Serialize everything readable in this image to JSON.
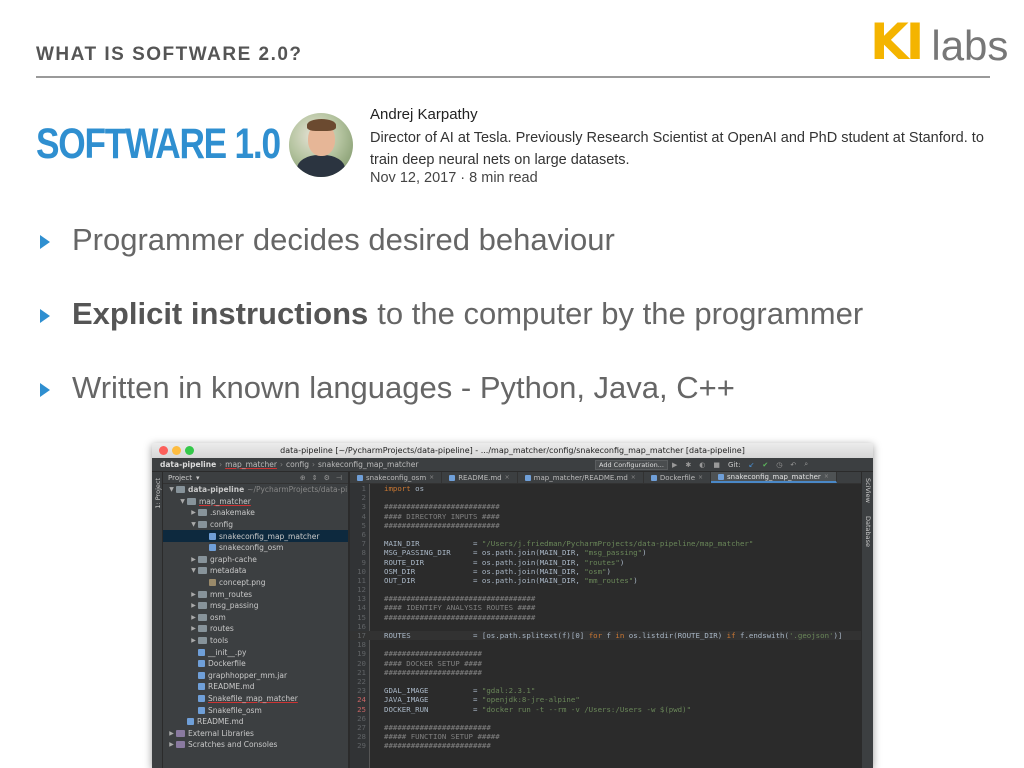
{
  "slide": {
    "header": "WHAT IS SOFTWARE 2.0?",
    "title": "SOFTWARE 1.0",
    "logo": {
      "ki": "KI",
      "labs": "labs",
      "color": "#f4b400"
    },
    "accent_color": "#2f8fd0"
  },
  "author": {
    "name": "Andrej Karpathy",
    "bio": "Director of AI at Tesla. Previously Research Scientist at OpenAI and PhD student at Stanford. to train deep neural nets on large datasets.",
    "meta": "Nov 12, 2017 · 8 min read"
  },
  "bullets": [
    {
      "bold": "",
      "text": "Programmer decides desired behaviour"
    },
    {
      "bold": "Explicit instructions",
      "text": "to the computer by the programmer"
    },
    {
      "bold": "",
      "text": "Written in known languages - Python, Java, C++"
    }
  ],
  "ide": {
    "window_title": "data-pipeline [~/PycharmProjects/data-pipeline] - .../map_matcher/config/snakeconfig_map_matcher [data-pipeline]",
    "breadcrumb": [
      "data-pipeline",
      "map_matcher",
      "config",
      "snakeconfig_map_matcher"
    ],
    "add_configuration": "Add Configuration...",
    "git_label": "Git:",
    "left_tool_label": "1: Project",
    "right_tool_labels": [
      "SciView",
      "Database"
    ],
    "project_panel_title": "Project",
    "tree": [
      {
        "label": "data-pipeline",
        "suffix": "~/PycharmProjects/data-pi",
        "type": "folder",
        "arrow": "▼"
      },
      {
        "label": "map_matcher",
        "type": "folder",
        "arrow": "▼"
      },
      {
        "label": ".snakemake",
        "type": "folder",
        "arrow": "▶"
      },
      {
        "label": "config",
        "type": "folder",
        "arrow": "▼"
      },
      {
        "label": "snakeconfig_map_matcher",
        "type": "file",
        "arrow": ""
      },
      {
        "label": "snakeconfig_osm",
        "type": "file",
        "arrow": ""
      },
      {
        "label": "graph-cache",
        "type": "folder",
        "arrow": "▶"
      },
      {
        "label": "metadata",
        "type": "folder",
        "arrow": "▼"
      },
      {
        "label": "concept.png",
        "type": "img",
        "arrow": ""
      },
      {
        "label": "mm_routes",
        "type": "folder",
        "arrow": "▶"
      },
      {
        "label": "msg_passing",
        "type": "folder",
        "arrow": "▶"
      },
      {
        "label": "osm",
        "type": "folder",
        "arrow": "▶"
      },
      {
        "label": "routes",
        "type": "folder",
        "arrow": "▶"
      },
      {
        "label": "tools",
        "type": "folder",
        "arrow": "▶"
      },
      {
        "label": "__init__.py",
        "type": "file",
        "arrow": ""
      },
      {
        "label": "Dockerfile",
        "type": "file",
        "arrow": ""
      },
      {
        "label": "graphhopper_mm.jar",
        "type": "file",
        "arrow": ""
      },
      {
        "label": "README.md",
        "type": "file",
        "arrow": ""
      },
      {
        "label": "Snakefile_map_matcher",
        "type": "file",
        "arrow": ""
      },
      {
        "label": "Snakefile_osm",
        "type": "file",
        "arrow": ""
      },
      {
        "label": "README.md",
        "type": "file",
        "arrow": ""
      },
      {
        "label": "External Libraries",
        "type": "lib",
        "arrow": "▶"
      },
      {
        "label": "Scratches and Consoles",
        "type": "lib",
        "arrow": "▶"
      }
    ],
    "tabs": [
      {
        "label": "snakeconfig_osm",
        "active": false
      },
      {
        "label": "README.md",
        "active": false
      },
      {
        "label": "map_matcher/README.md",
        "active": false
      },
      {
        "label": "Dockerfile",
        "active": false
      },
      {
        "label": "snakeconfig_map_matcher",
        "active": true
      }
    ],
    "code": [
      {
        "n": "1",
        "t": "import os"
      },
      {
        "n": "2",
        "t": ""
      },
      {
        "n": "3",
        "t": "##########################"
      },
      {
        "n": "4",
        "t": "#### DIRECTORY INPUTS ####"
      },
      {
        "n": "5",
        "t": "##########################"
      },
      {
        "n": "6",
        "t": ""
      },
      {
        "n": "7",
        "t": "MAIN_DIR            = \"/Users/j.friedman/PycharmProjects/data-pipeline/map_matcher\""
      },
      {
        "n": "8",
        "t": "MSG_PASSING_DIR     = os.path.join(MAIN_DIR, \"msg_passing\")"
      },
      {
        "n": "9",
        "t": "ROUTE_DIR           = os.path.join(MAIN_DIR, \"routes\")"
      },
      {
        "n": "10",
        "t": "OSM_DIR             = os.path.join(MAIN_DIR, \"osm\")"
      },
      {
        "n": "11",
        "t": "OUT_DIR             = os.path.join(MAIN_DIR, \"mm_routes\")"
      },
      {
        "n": "12",
        "t": ""
      },
      {
        "n": "13",
        "t": "##################################"
      },
      {
        "n": "14",
        "t": "#### IDENTIFY ANALYSIS ROUTES ####"
      },
      {
        "n": "15",
        "t": "##################################"
      },
      {
        "n": "16",
        "t": ""
      },
      {
        "n": "17",
        "t": "ROUTES              = [os.path.splitext(f)[0] for f in os.listdir(ROUTE_DIR) if f.endswith('.geojson')]"
      },
      {
        "n": "18",
        "t": ""
      },
      {
        "n": "19",
        "t": "######################"
      },
      {
        "n": "20",
        "t": "#### DOCKER SETUP ####"
      },
      {
        "n": "21",
        "t": "######################"
      },
      {
        "n": "22",
        "t": ""
      },
      {
        "n": "23",
        "t": "GDAL_IMAGE          = \"gdal:2.3.1\""
      },
      {
        "n": "24",
        "t": "JAVA_IMAGE          = \"openjdk:8-jre-alpine\""
      },
      {
        "n": "25",
        "t": "DOCKER_RUN          = \"docker run -t --rm -v /Users:/Users -w $(pwd)\""
      },
      {
        "n": "26",
        "t": ""
      },
      {
        "n": "27",
        "t": "########################"
      },
      {
        "n": "28",
        "t": "##### FUNCTION SETUP #####"
      },
      {
        "n": "29",
        "t": "########################"
      }
    ]
  }
}
